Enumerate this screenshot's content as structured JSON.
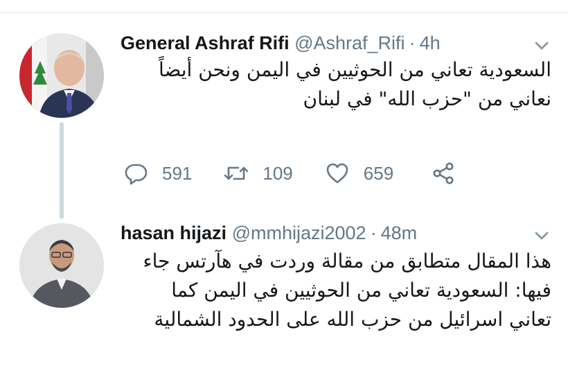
{
  "tweets": [
    {
      "name": "General Ashraf Rifi",
      "handle": "@Ashraf_Rifi",
      "separator": "·",
      "time": "4h",
      "lines": [
        "السعودية تعاني من الحوثيين في اليمن ونحن أيضاً",
        "نعاني من \"حزب الله\" في لبنان"
      ],
      "actions": {
        "reply_count": "591",
        "retweet_count": "109",
        "like_count": "659"
      }
    },
    {
      "name": "hasan hijazi",
      "handle": "@mmhijazi2002",
      "separator": "·",
      "time": "48m",
      "lines": [
        "هذا المقال متطابق من مقالة وردت في هآرتس جاء",
        "فيها: السعودية تعاني من الحوثيين في اليمن كما",
        "تعاني اسرائيل من حزب الله على الحدود الشمالية"
      ]
    }
  ],
  "icons": {
    "reply": "reply-icon",
    "retweet": "retweet-icon",
    "like": "like-icon",
    "share": "share-icon",
    "caret": "chevron-down-icon"
  },
  "colors": {
    "text": "#14171a",
    "secondary": "#657786",
    "thread_line": "#cfd9de",
    "divider": "#e6ecf0"
  }
}
